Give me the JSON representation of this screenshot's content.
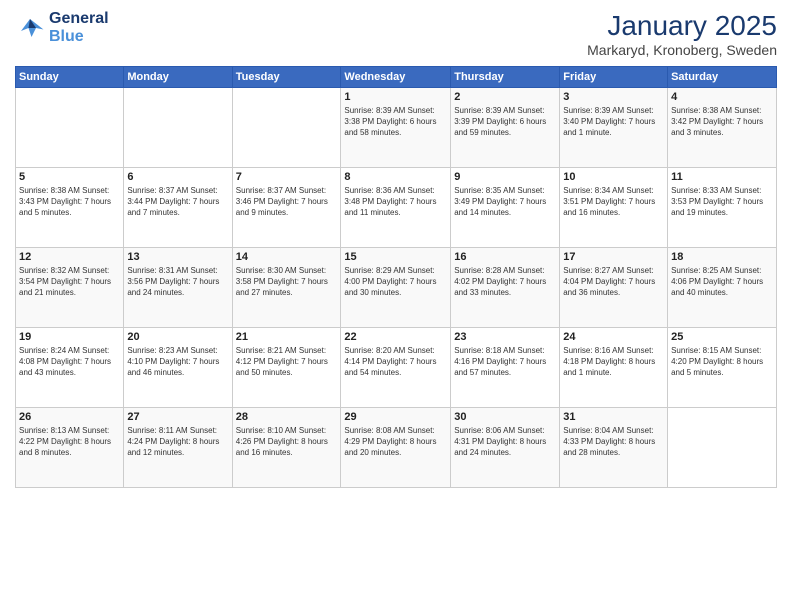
{
  "logo": {
    "line1": "General",
    "line2": "Blue"
  },
  "header": {
    "title": "January 2025",
    "subtitle": "Markaryd, Kronoberg, Sweden"
  },
  "days_of_week": [
    "Sunday",
    "Monday",
    "Tuesday",
    "Wednesday",
    "Thursday",
    "Friday",
    "Saturday"
  ],
  "weeks": [
    [
      {
        "day": "",
        "info": ""
      },
      {
        "day": "",
        "info": ""
      },
      {
        "day": "",
        "info": ""
      },
      {
        "day": "1",
        "info": "Sunrise: 8:39 AM\nSunset: 3:38 PM\nDaylight: 6 hours\nand 58 minutes."
      },
      {
        "day": "2",
        "info": "Sunrise: 8:39 AM\nSunset: 3:39 PM\nDaylight: 6 hours\nand 59 minutes."
      },
      {
        "day": "3",
        "info": "Sunrise: 8:39 AM\nSunset: 3:40 PM\nDaylight: 7 hours\nand 1 minute."
      },
      {
        "day": "4",
        "info": "Sunrise: 8:38 AM\nSunset: 3:42 PM\nDaylight: 7 hours\nand 3 minutes."
      }
    ],
    [
      {
        "day": "5",
        "info": "Sunrise: 8:38 AM\nSunset: 3:43 PM\nDaylight: 7 hours\nand 5 minutes."
      },
      {
        "day": "6",
        "info": "Sunrise: 8:37 AM\nSunset: 3:44 PM\nDaylight: 7 hours\nand 7 minutes."
      },
      {
        "day": "7",
        "info": "Sunrise: 8:37 AM\nSunset: 3:46 PM\nDaylight: 7 hours\nand 9 minutes."
      },
      {
        "day": "8",
        "info": "Sunrise: 8:36 AM\nSunset: 3:48 PM\nDaylight: 7 hours\nand 11 minutes."
      },
      {
        "day": "9",
        "info": "Sunrise: 8:35 AM\nSunset: 3:49 PM\nDaylight: 7 hours\nand 14 minutes."
      },
      {
        "day": "10",
        "info": "Sunrise: 8:34 AM\nSunset: 3:51 PM\nDaylight: 7 hours\nand 16 minutes."
      },
      {
        "day": "11",
        "info": "Sunrise: 8:33 AM\nSunset: 3:53 PM\nDaylight: 7 hours\nand 19 minutes."
      }
    ],
    [
      {
        "day": "12",
        "info": "Sunrise: 8:32 AM\nSunset: 3:54 PM\nDaylight: 7 hours\nand 21 minutes."
      },
      {
        "day": "13",
        "info": "Sunrise: 8:31 AM\nSunset: 3:56 PM\nDaylight: 7 hours\nand 24 minutes."
      },
      {
        "day": "14",
        "info": "Sunrise: 8:30 AM\nSunset: 3:58 PM\nDaylight: 7 hours\nand 27 minutes."
      },
      {
        "day": "15",
        "info": "Sunrise: 8:29 AM\nSunset: 4:00 PM\nDaylight: 7 hours\nand 30 minutes."
      },
      {
        "day": "16",
        "info": "Sunrise: 8:28 AM\nSunset: 4:02 PM\nDaylight: 7 hours\nand 33 minutes."
      },
      {
        "day": "17",
        "info": "Sunrise: 8:27 AM\nSunset: 4:04 PM\nDaylight: 7 hours\nand 36 minutes."
      },
      {
        "day": "18",
        "info": "Sunrise: 8:25 AM\nSunset: 4:06 PM\nDaylight: 7 hours\nand 40 minutes."
      }
    ],
    [
      {
        "day": "19",
        "info": "Sunrise: 8:24 AM\nSunset: 4:08 PM\nDaylight: 7 hours\nand 43 minutes."
      },
      {
        "day": "20",
        "info": "Sunrise: 8:23 AM\nSunset: 4:10 PM\nDaylight: 7 hours\nand 46 minutes."
      },
      {
        "day": "21",
        "info": "Sunrise: 8:21 AM\nSunset: 4:12 PM\nDaylight: 7 hours\nand 50 minutes."
      },
      {
        "day": "22",
        "info": "Sunrise: 8:20 AM\nSunset: 4:14 PM\nDaylight: 7 hours\nand 54 minutes."
      },
      {
        "day": "23",
        "info": "Sunrise: 8:18 AM\nSunset: 4:16 PM\nDaylight: 7 hours\nand 57 minutes."
      },
      {
        "day": "24",
        "info": "Sunrise: 8:16 AM\nSunset: 4:18 PM\nDaylight: 8 hours\nand 1 minute."
      },
      {
        "day": "25",
        "info": "Sunrise: 8:15 AM\nSunset: 4:20 PM\nDaylight: 8 hours\nand 5 minutes."
      }
    ],
    [
      {
        "day": "26",
        "info": "Sunrise: 8:13 AM\nSunset: 4:22 PM\nDaylight: 8 hours\nand 8 minutes."
      },
      {
        "day": "27",
        "info": "Sunrise: 8:11 AM\nSunset: 4:24 PM\nDaylight: 8 hours\nand 12 minutes."
      },
      {
        "day": "28",
        "info": "Sunrise: 8:10 AM\nSunset: 4:26 PM\nDaylight: 8 hours\nand 16 minutes."
      },
      {
        "day": "29",
        "info": "Sunrise: 8:08 AM\nSunset: 4:29 PM\nDaylight: 8 hours\nand 20 minutes."
      },
      {
        "day": "30",
        "info": "Sunrise: 8:06 AM\nSunset: 4:31 PM\nDaylight: 8 hours\nand 24 minutes."
      },
      {
        "day": "31",
        "info": "Sunrise: 8:04 AM\nSunset: 4:33 PM\nDaylight: 8 hours\nand 28 minutes."
      },
      {
        "day": "",
        "info": ""
      }
    ]
  ]
}
